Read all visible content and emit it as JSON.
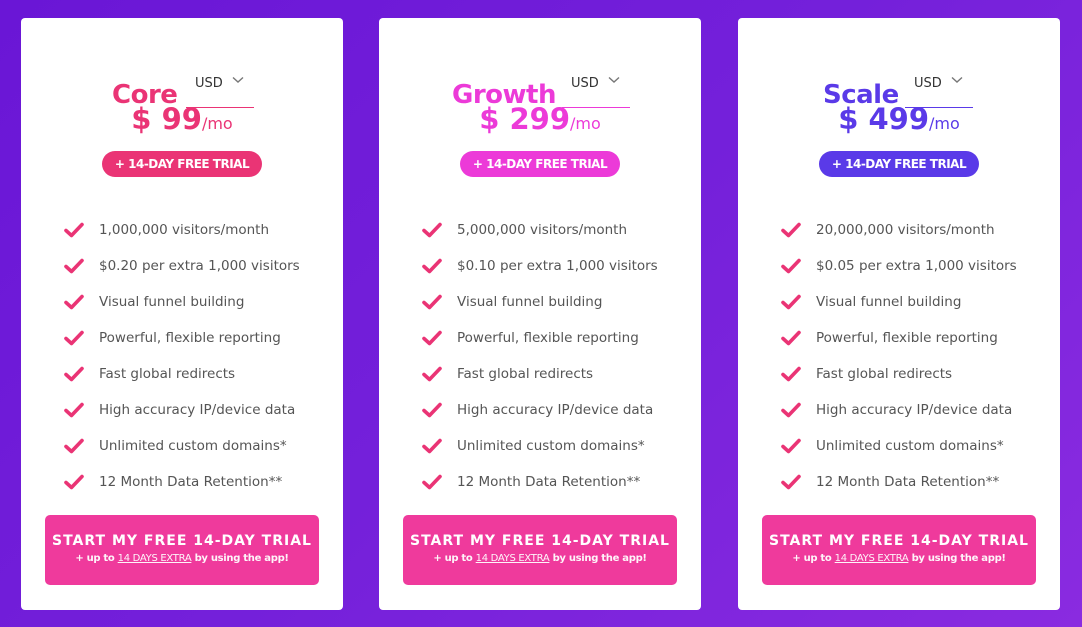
{
  "plans": [
    {
      "name": "Core",
      "accent": "#ea3475",
      "currency": "USD",
      "price": "$ 99",
      "period": "/mo",
      "trial_badge": "+ 14-DAY FREE TRIAL",
      "features": [
        "1,000,000 visitors/month",
        "$0.20 per extra 1,000 visitors",
        "Visual funnel building",
        "Powerful, flexible reporting",
        "Fast global redirects",
        "High accuracy IP/device data",
        "Unlimited custom domains*",
        "12 Month Data Retention**"
      ],
      "cta": {
        "label": "START MY FREE 14-DAY TRIAL",
        "sub_prefix": "+ up to",
        "sub_link": "14 DAYS EXTRA",
        "sub_suffix": "by using the app!"
      }
    },
    {
      "name": "Growth",
      "accent": "#ec3ad8",
      "currency": "USD",
      "price": "$ 299",
      "period": "/mo",
      "trial_badge": "+ 14-DAY FREE TRIAL",
      "features": [
        "5,000,000 visitors/month",
        "$0.10 per extra 1,000 visitors",
        "Visual funnel building",
        "Powerful, flexible reporting",
        "Fast global redirects",
        "High accuracy IP/device data",
        "Unlimited custom domains*",
        "12 Month Data Retention**"
      ],
      "cta": {
        "label": "START MY FREE 14-DAY TRIAL",
        "sub_prefix": "+ up to",
        "sub_link": "14 DAYS EXTRA",
        "sub_suffix": "by using the app!"
      }
    },
    {
      "name": "Scale",
      "accent": "#5a3ae8",
      "currency": "USD",
      "price": "$ 499",
      "period": "/mo",
      "trial_badge": "+ 14-DAY FREE TRIAL",
      "features": [
        "20,000,000 visitors/month",
        "$0.05 per extra 1,000 visitors",
        "Visual funnel building",
        "Powerful, flexible reporting",
        "Fast global redirects",
        "High accuracy IP/device data",
        "Unlimited custom domains*",
        "12 Month Data Retention**"
      ],
      "cta": {
        "label": "START MY FREE 14-DAY TRIAL",
        "sub_prefix": "+ up to",
        "sub_link": "14 DAYS EXTRA",
        "sub_suffix": "by using the app!"
      }
    }
  ],
  "icons": {
    "check": "checkmark-icon",
    "chevron": "chevron-down-icon"
  },
  "colors": {
    "check": "#ea3475",
    "cta_bg": "#ef3a9c",
    "background": "#7420da"
  }
}
